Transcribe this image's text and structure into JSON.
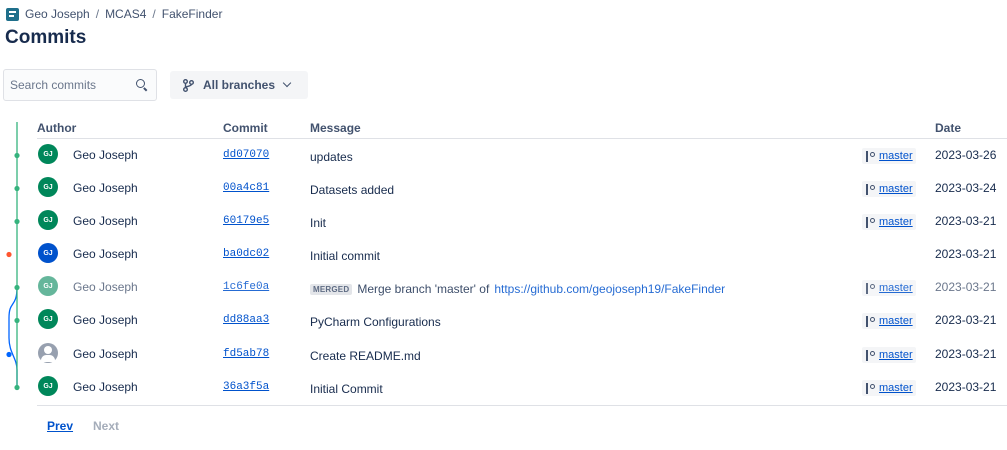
{
  "breadcrumb": {
    "owner": "Geo Joseph",
    "project": "MCAS4",
    "repo": "FakeFinder",
    "separator": "/"
  },
  "page_title": "Commits",
  "search": {
    "placeholder": "Search commits"
  },
  "branch_filter": {
    "label": "All branches"
  },
  "table": {
    "headers": {
      "author": "Author",
      "commit": "Commit",
      "message": "Message",
      "date": "Date"
    },
    "rows": [
      {
        "initials": "GJ",
        "avatar_color": "#00875a",
        "author": "Geo Joseph",
        "hash": "dd07070",
        "lozenge": "",
        "message": "updates",
        "link": "",
        "branch": "master",
        "date": "2023-03-26"
      },
      {
        "initials": "GJ",
        "avatar_color": "#00875a",
        "author": "Geo Joseph",
        "hash": "00a4c81",
        "lozenge": "",
        "message": "Datasets added",
        "link": "",
        "branch": "master",
        "date": "2023-03-24"
      },
      {
        "initials": "GJ",
        "avatar_color": "#00875a",
        "author": "Geo Joseph",
        "hash": "60179e5",
        "lozenge": "",
        "message": "Init",
        "link": "",
        "branch": "master",
        "date": "2023-03-21"
      },
      {
        "initials": "GJ",
        "avatar_color": "#0052cc",
        "author": "Geo Joseph",
        "hash": "ba0dc02",
        "lozenge": "",
        "message": "Initial commit",
        "link": "",
        "branch": "",
        "date": "2023-03-21"
      },
      {
        "initials": "GJ",
        "avatar_color": "#00875a",
        "author": "Geo Joseph",
        "hash": "1c6fe0a",
        "lozenge": "MERGED",
        "message": "Merge branch 'master' of",
        "link": "https://github.com/geojoseph19/FakeFinder",
        "branch": "master",
        "date": "2023-03-21"
      },
      {
        "initials": "GJ",
        "avatar_color": "#00875a",
        "author": "Geo Joseph",
        "hash": "dd88aa3",
        "lozenge": "",
        "message": "PyCharm Configurations",
        "link": "",
        "branch": "master",
        "date": "2023-03-21"
      },
      {
        "initials": "",
        "avatar_color": "#97a0af",
        "author": "Geo Joseph",
        "hash": "fd5ab78",
        "lozenge": "",
        "message": "Create README.md",
        "link": "",
        "branch": "master",
        "date": "2023-03-21"
      },
      {
        "initials": "GJ",
        "avatar_color": "#00875a",
        "author": "Geo Joseph",
        "hash": "36a3f5a",
        "lozenge": "",
        "message": "Initial Commit",
        "link": "",
        "branch": "master",
        "date": "2023-03-21"
      }
    ]
  },
  "pagination": {
    "prev": "Prev",
    "next": "Next"
  },
  "colors": {
    "graph_green": "#36b37e",
    "graph_blue": "#0065ff",
    "graph_red": "#ff5630",
    "link": "#0052cc"
  }
}
